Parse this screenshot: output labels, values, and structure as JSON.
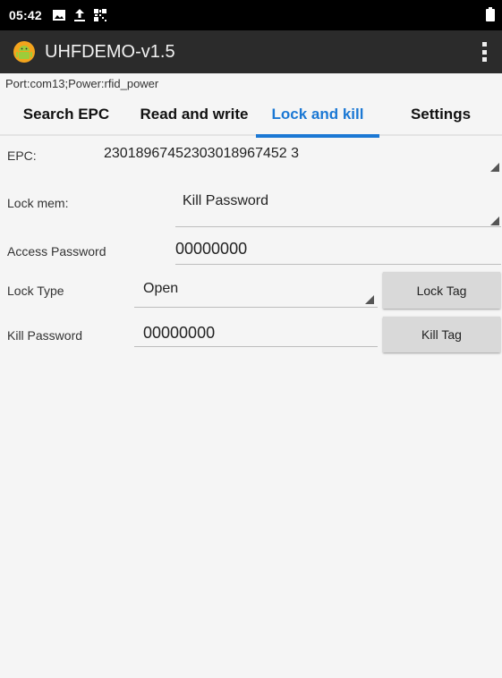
{
  "status_bar": {
    "time": "05:42",
    "icons": [
      "image-icon",
      "upload-icon",
      "qr-icon",
      "battery-icon"
    ]
  },
  "app_bar": {
    "title": "UHFDEMO-v1.5",
    "logo_icon": "android-logo-icon",
    "menu_icon": "overflow-menu-icon"
  },
  "port_info": "Port:com13;Power:rfid_power",
  "tabs": [
    {
      "label": "Search EPC",
      "active": false
    },
    {
      "label": "Read and write",
      "active": false
    },
    {
      "label": "Lock and kill",
      "active": true
    },
    {
      "label": "Settings",
      "active": false
    }
  ],
  "form": {
    "epc_label": "EPC:",
    "epc_value": "23018967452303018967452 3",
    "lock_mem_label": "Lock mem:",
    "lock_mem_value": "Kill Password",
    "access_password_label": "Access Password",
    "access_password_value": "00000000",
    "lock_type_label": "Lock Type",
    "lock_type_value": "Open",
    "lock_tag_button": "Lock Tag",
    "kill_password_label": "Kill Password",
    "kill_password_value": "00000000",
    "kill_tag_button": "Kill Tag"
  },
  "colors": {
    "accent": "#1b78d4",
    "app_bar": "#2b2b2b",
    "status_bar": "#000000",
    "background": "#f5f5f5",
    "button": "#d9d9d9"
  }
}
